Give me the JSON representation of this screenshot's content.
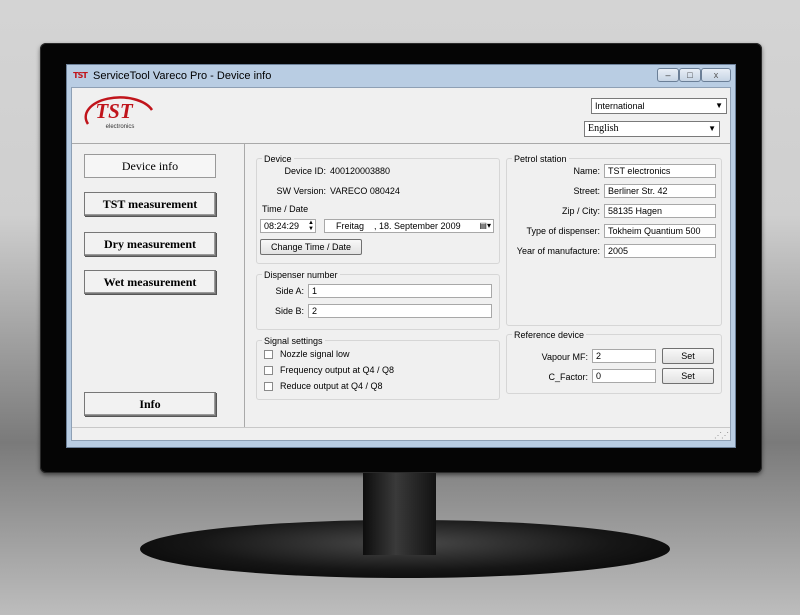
{
  "window": {
    "icon_text": "TST",
    "title": "ServiceTool Vareco Pro - Device info",
    "minimize": "–",
    "maximize": "□",
    "close": "x"
  },
  "header": {
    "logo_text": "TST",
    "logo_subtext": "electronics",
    "region_select": "International",
    "language_select": "English"
  },
  "nav": {
    "device_info": "Device info",
    "tst_measurement": "TST measurement",
    "dry_measurement": "Dry measurement",
    "wet_measurement": "Wet measurement",
    "info": "Info"
  },
  "device": {
    "group_title": "Device",
    "device_id_label": "Device ID:",
    "device_id": "400120003880",
    "sw_version_label": "SW Version:",
    "sw_version": "VARECO 080424",
    "time_date_title": "Time / Date",
    "time_value": "08:24:29",
    "date_weekday": "Freitag",
    "date_value": ", 18. September 2009",
    "change_button": "Change Time / Date"
  },
  "petrol_station": {
    "group_title": "Petrol station",
    "name_label": "Name:",
    "name": "TST electronics",
    "street_label": "Street:",
    "street": "Berliner Str. 42",
    "zip_city_label": "Zip / City:",
    "zip_city": "58135 Hagen",
    "dispenser_type_label": "Type of dispenser:",
    "dispenser_type": "Tokheim Quantium 500",
    "year_label": "Year of manufacture:",
    "year": "2005"
  },
  "dispenser_number": {
    "group_title": "Dispenser number",
    "side_a_label": "Side A:",
    "side_a": "1",
    "side_b_label": "Side B:",
    "side_b": "2"
  },
  "signal_settings": {
    "group_title": "Signal settings",
    "nozzle": "Nozzle signal low",
    "frequency": "Frequency output at Q4 / Q8",
    "reduce": "Reduce output at Q4 / Q8"
  },
  "reference_device": {
    "group_title": "Reference device",
    "vapour_label": "Vapour MF:",
    "vapour_value": "2",
    "c_factor_label": "C_Factor:",
    "c_factor_value": "0",
    "set_label": "Set"
  },
  "colors": {
    "logo_red": "#c0141b",
    "window_frame": "#b9cde3",
    "client_bg": "#f0f0f0"
  }
}
